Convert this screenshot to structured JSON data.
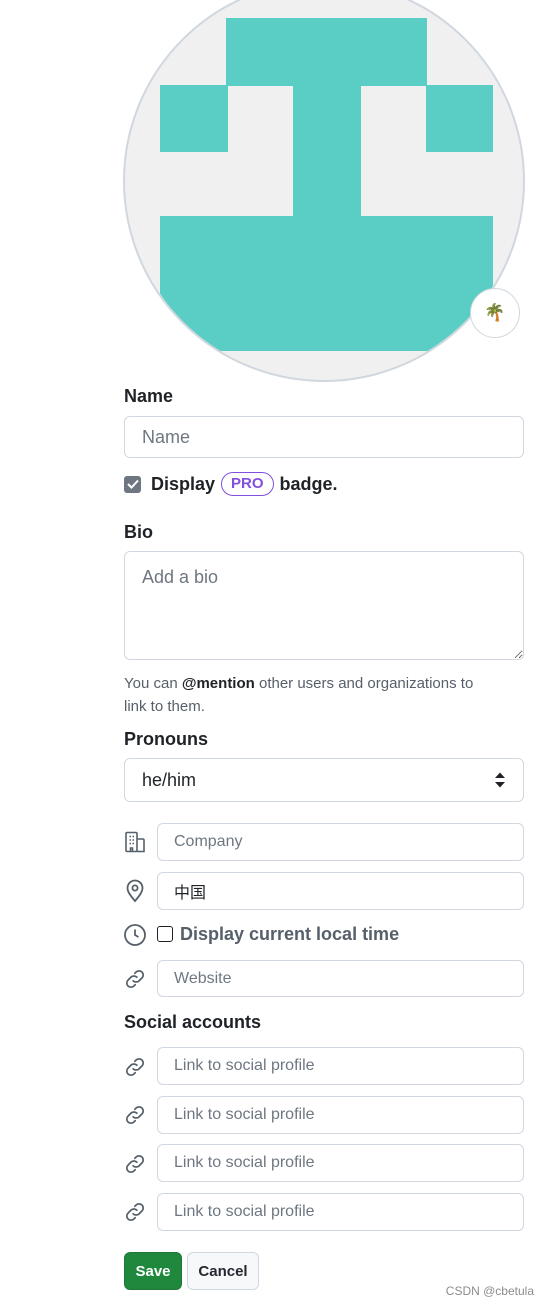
{
  "avatar": {
    "edit_glyph": "🌴",
    "fill_color": "#5acec5"
  },
  "name": {
    "label": "Name",
    "placeholder": "Name",
    "value": ""
  },
  "pro_badge": {
    "prefix": "Display",
    "badge": "PRO",
    "suffix": "badge.",
    "checked": true
  },
  "bio": {
    "label": "Bio",
    "placeholder": "Add a bio",
    "help_prefix": "You can",
    "help_mention": "@mention",
    "help_line1_suffix": "other users and organizations to",
    "help_line2": "link to them."
  },
  "pronouns": {
    "label": "Pronouns",
    "value": "he/him"
  },
  "company": {
    "placeholder": "Company",
    "value": ""
  },
  "location": {
    "value": "中国"
  },
  "local_time": {
    "label": "Display current local time",
    "checked": false
  },
  "website": {
    "placeholder": "Website",
    "value": ""
  },
  "social": {
    "label": "Social accounts",
    "items": [
      {
        "placeholder": "Link to social profile"
      },
      {
        "placeholder": "Link to social profile"
      },
      {
        "placeholder": "Link to social profile"
      },
      {
        "placeholder": "Link to social profile"
      }
    ]
  },
  "actions": {
    "save": "Save",
    "cancel": "Cancel"
  },
  "watermark": "CSDN @cbetula",
  "colors": {
    "primary": "#1f883d",
    "pro": "#8250df",
    "border": "#d0d7de"
  }
}
